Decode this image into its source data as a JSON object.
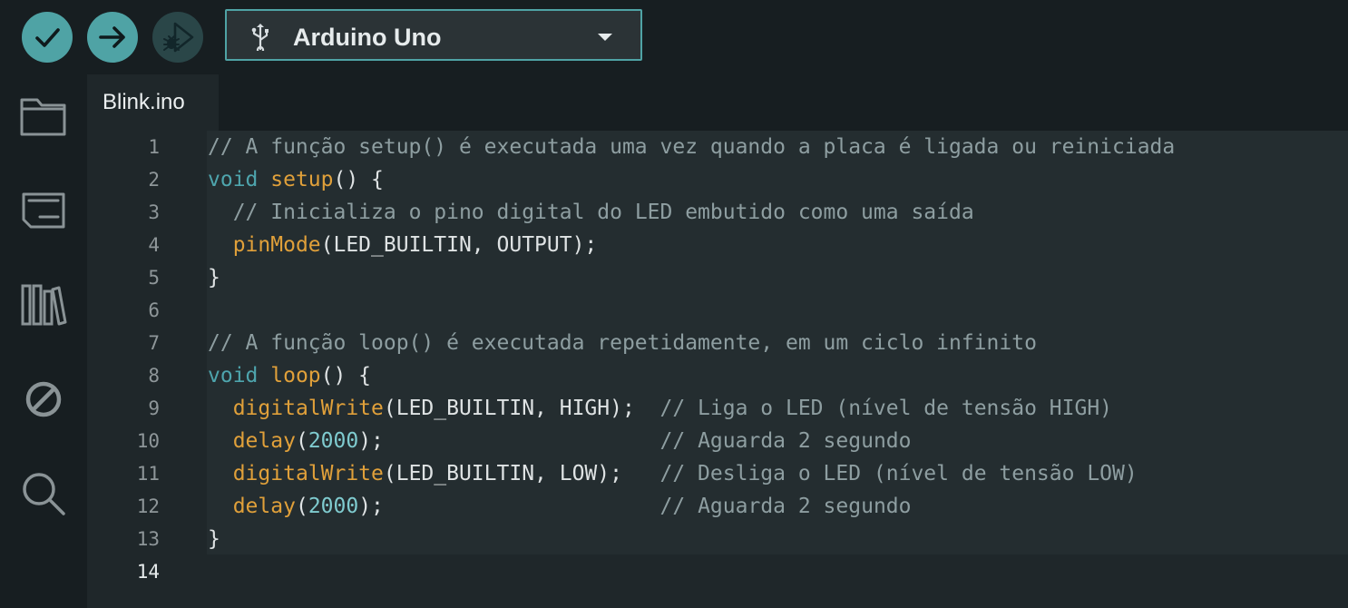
{
  "toolbar": {
    "verify_icon": "check-icon",
    "upload_icon": "arrow-right-icon",
    "debug_icon": "debug-icon",
    "board": {
      "label": "Arduino Uno",
      "icon": "usb-icon",
      "caret": "caret-down-icon"
    }
  },
  "sidebar": {
    "items": [
      {
        "name": "sketchbook",
        "icon": "folder-icon"
      },
      {
        "name": "boards-manager",
        "icon": "board-icon"
      },
      {
        "name": "library-manager",
        "icon": "library-icon"
      },
      {
        "name": "debug",
        "icon": "no-entry-icon"
      },
      {
        "name": "search",
        "icon": "search-icon"
      }
    ]
  },
  "editor": {
    "tab": {
      "label": "Blink.ino"
    },
    "active_line": 14,
    "line_numbers": [
      "1",
      "2",
      "3",
      "4",
      "5",
      "6",
      "7",
      "8",
      "9",
      "10",
      "11",
      "12",
      "13",
      "14"
    ],
    "lines": [
      [
        {
          "t": "cm",
          "v": "// A função setup() é executada uma vez quando a placa é ligada ou reiniciada"
        }
      ],
      [
        {
          "t": "kw",
          "v": "void"
        },
        {
          "t": "tx",
          "v": " "
        },
        {
          "t": "fn",
          "v": "setup"
        },
        {
          "t": "tx",
          "v": "() {"
        }
      ],
      [
        {
          "t": "tx",
          "v": "  "
        },
        {
          "t": "cm",
          "v": "// Inicializa o pino digital do LED embutido como uma saída"
        }
      ],
      [
        {
          "t": "tx",
          "v": "  "
        },
        {
          "t": "fn",
          "v": "pinMode"
        },
        {
          "t": "tx",
          "v": "(LED_BUILTIN, OUTPUT);"
        }
      ],
      [
        {
          "t": "tx",
          "v": "}"
        }
      ],
      [
        {
          "t": "tx",
          "v": ""
        }
      ],
      [
        {
          "t": "cm",
          "v": "// A função loop() é executada repetidamente, em um ciclo infinito"
        }
      ],
      [
        {
          "t": "kw",
          "v": "void"
        },
        {
          "t": "tx",
          "v": " "
        },
        {
          "t": "fn",
          "v": "loop"
        },
        {
          "t": "tx",
          "v": "() {"
        }
      ],
      [
        {
          "t": "tx",
          "v": "  "
        },
        {
          "t": "fn",
          "v": "digitalWrite"
        },
        {
          "t": "tx",
          "v": "(LED_BUILTIN, HIGH);  "
        },
        {
          "t": "cm",
          "v": "// Liga o LED (nível de tensão HIGH)"
        }
      ],
      [
        {
          "t": "tx",
          "v": "  "
        },
        {
          "t": "fn",
          "v": "delay"
        },
        {
          "t": "tx",
          "v": "("
        },
        {
          "t": "num",
          "v": "2000"
        },
        {
          "t": "tx",
          "v": ");                      "
        },
        {
          "t": "cm",
          "v": "// Aguarda 2 segundo"
        }
      ],
      [
        {
          "t": "tx",
          "v": "  "
        },
        {
          "t": "fn",
          "v": "digitalWrite"
        },
        {
          "t": "tx",
          "v": "(LED_BUILTIN, LOW);   "
        },
        {
          "t": "cm",
          "v": "// Desliga o LED (nível de tensão LOW)"
        }
      ],
      [
        {
          "t": "tx",
          "v": "  "
        },
        {
          "t": "fn",
          "v": "delay"
        },
        {
          "t": "tx",
          "v": "("
        },
        {
          "t": "num",
          "v": "2000"
        },
        {
          "t": "tx",
          "v": ");                      "
        },
        {
          "t": "cm",
          "v": "// Aguarda 2 segundo"
        }
      ],
      [
        {
          "t": "tx",
          "v": "}"
        }
      ],
      [
        {
          "t": "tx",
          "v": ""
        }
      ]
    ]
  },
  "colors": {
    "accent": "#4fa3a5",
    "comment": "#8e9ea1",
    "keyword": "#4ea5ad",
    "function": "#e0a03a",
    "number": "#7fcbcf",
    "text": "#dfe3e4"
  }
}
